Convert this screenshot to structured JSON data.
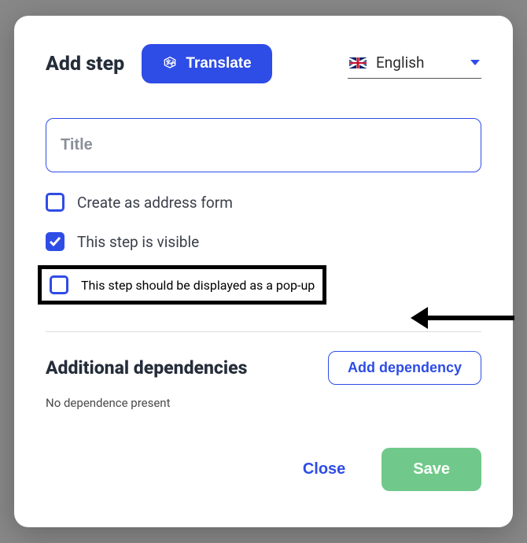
{
  "header": {
    "title": "Add step",
    "translate_label": "Translate",
    "language": "English"
  },
  "form": {
    "title_placeholder": "Title",
    "title_value": "",
    "checkboxes": {
      "address_form": {
        "label": "Create as address form",
        "checked": false
      },
      "visible": {
        "label": "This step is visible",
        "checked": true
      },
      "popup": {
        "label": "This step should be displayed as a pop-up",
        "checked": false
      }
    }
  },
  "dependencies": {
    "title": "Additional dependencies",
    "add_label": "Add dependency",
    "empty_text": "No dependence present"
  },
  "footer": {
    "close": "Close",
    "save": "Save"
  }
}
